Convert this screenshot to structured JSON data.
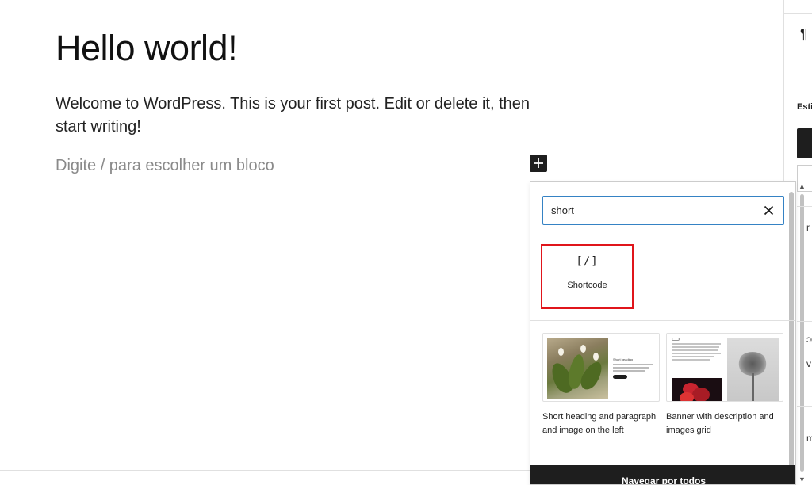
{
  "post": {
    "title": "Hello world!",
    "paragraph": "Welcome to WordPress. This is your first post. Edit or delete it, then start writing!",
    "block_placeholder": "Digite / para escolher um bloco"
  },
  "sidebar": {
    "block_icon": "¶",
    "label_fragment": "Esti",
    "fragments": [
      "r",
      "ɔe",
      "v",
      "m"
    ]
  },
  "inserter": {
    "search": {
      "value": "short",
      "clear_icon": "close-icon"
    },
    "blocks": [
      {
        "icon_text": "[/]",
        "label": "Shortcode"
      }
    ],
    "patterns": [
      {
        "title": "Short heading and paragraph and image on the left"
      },
      {
        "title": "Banner with description and images grid"
      }
    ],
    "browse_all_label": "Navegar por todos"
  },
  "colors": {
    "accent_focus": "#3582c4",
    "highlight": "#e0151b",
    "dark": "#1e1e1e"
  }
}
